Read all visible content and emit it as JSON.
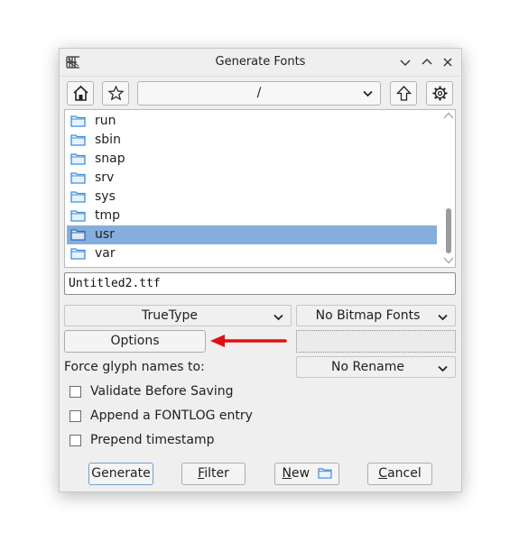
{
  "window": {
    "title": "Generate Fonts"
  },
  "toolbar": {
    "path": "/"
  },
  "files": [
    {
      "name": "run",
      "selected": false
    },
    {
      "name": "sbin",
      "selected": false
    },
    {
      "name": "snap",
      "selected": false
    },
    {
      "name": "srv",
      "selected": false
    },
    {
      "name": "sys",
      "selected": false
    },
    {
      "name": "tmp",
      "selected": false
    },
    {
      "name": "usr",
      "selected": true
    },
    {
      "name": "var",
      "selected": false
    }
  ],
  "filename": {
    "value": "Untitled2.ttf"
  },
  "format": {
    "outline": "TrueType",
    "bitmap": "No Bitmap Fonts"
  },
  "options": {
    "label": "Options"
  },
  "glyph_names": {
    "label": "Force glyph names to:",
    "value": "No Rename"
  },
  "checkboxes": {
    "validate": "Validate Before Saving",
    "fontlog": "Append a FONTLOG entry",
    "timestamp": "Prepend timestamp"
  },
  "buttons": {
    "generate": "Generate",
    "filter_rest": "ilter",
    "new_rest": "ew",
    "cancel_rest": "ancel"
  },
  "colors": {
    "selection": "#86aedc",
    "annotation_arrow": "#e01010",
    "folder": "#3d8ee0"
  }
}
